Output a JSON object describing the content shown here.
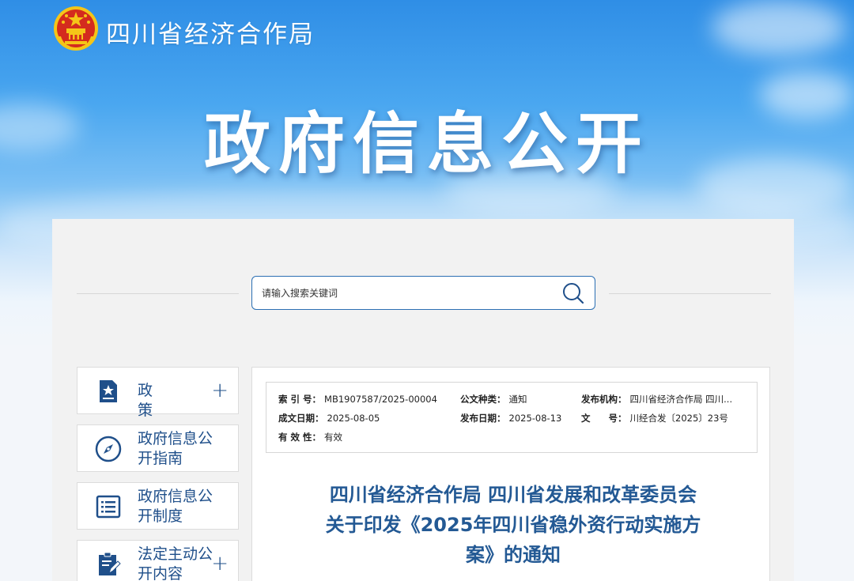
{
  "header": {
    "site_title": "四川省经济合作局",
    "hero_title": "政府信息公开"
  },
  "search": {
    "placeholder": "请输入搜索关键词"
  },
  "sidebar": {
    "items": [
      {
        "label": "政 策",
        "icon": "policy-star-icon",
        "expandable": true
      },
      {
        "label": "政府信息公开指南",
        "icon": "compass-icon",
        "expandable": false
      },
      {
        "label": "政府信息公开制度",
        "icon": "list-document-icon",
        "expandable": false
      },
      {
        "label": "法定主动公开内容",
        "icon": "clipboard-pen-icon",
        "expandable": true
      }
    ]
  },
  "meta": {
    "index_label": "索 引 号：",
    "index_value": "MB1907587/2025-00004",
    "doc_type_label": "公文种类：",
    "doc_type_value": "通知",
    "publisher_label": "发布机构：",
    "publisher_value": "四川省经济合作局 四川...",
    "created_label": "成文日期：",
    "created_value": "2025-08-05",
    "published_label": "发布日期：",
    "published_value": "2025-08-13",
    "docno_label": "文　　号：",
    "docno_value": "川经合发〔2025〕23号",
    "validity_label": "有 效 性：",
    "validity_value": "有效"
  },
  "document": {
    "title_line1": "四川省经济合作局 四川省发展和改革委员会",
    "title_line2": "关于印发《2025年四川省稳外资行动实施方",
    "title_line3": "案》的通知"
  },
  "colors": {
    "brand_blue": "#1f4f8a",
    "title_blue": "#235994",
    "search_border": "#2b6fb3",
    "emblem_red": "#d42b1e",
    "emblem_gold": "#f5c518"
  }
}
